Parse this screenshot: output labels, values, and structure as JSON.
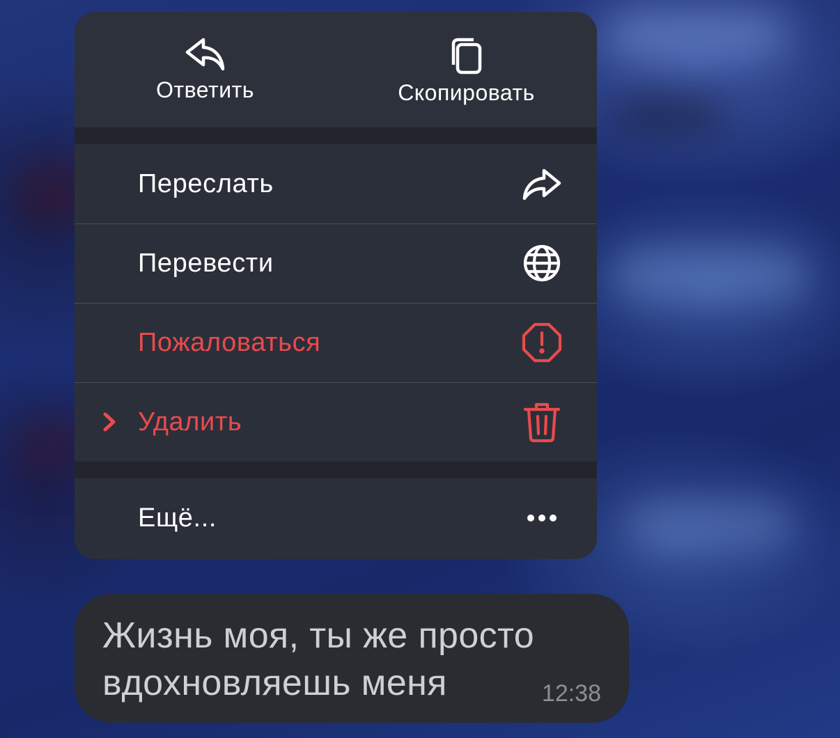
{
  "menu": {
    "top_actions": [
      {
        "label": "Ответить",
        "icon": "reply-icon"
      },
      {
        "label": "Скопировать",
        "icon": "copy-icon"
      }
    ],
    "items": [
      {
        "label": "Переслать",
        "icon": "forward-icon"
      },
      {
        "label": "Перевести",
        "icon": "globe-icon"
      },
      {
        "label": "Пожаловаться",
        "icon": "report-octagon-icon",
        "color": "#ea4a4c"
      },
      {
        "label": "Удалить",
        "icon": "trash-icon",
        "color": "#ea4a4c",
        "selected_indicator": "chevron-right-icon"
      }
    ],
    "more": {
      "label": "Ещё...",
      "icon": "ellipsis-icon"
    }
  },
  "message": {
    "text": "Жизнь моя, ты же просто вдохновляешь меня",
    "time": "12:38"
  },
  "colors": {
    "danger": "#ea4a4c",
    "menu_background": "#2b2f3a",
    "bubble_background": "#2a2c31"
  }
}
